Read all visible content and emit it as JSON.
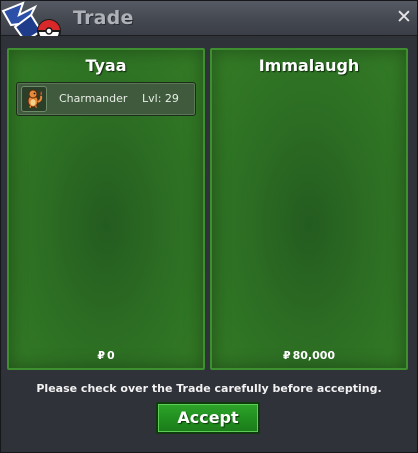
{
  "window": {
    "title": "Trade",
    "close_label": "✕",
    "logo_icon": "pokeball-logo-icon"
  },
  "trade": {
    "left_player": {
      "name": "Tyaa",
      "items": [
        {
          "icon": "charmander-icon",
          "name": "Charmander",
          "level_label": "Lvl: 29"
        }
      ],
      "currency_symbol": "₽",
      "money": "0"
    },
    "right_player": {
      "name": "Immalaugh",
      "items": [],
      "currency_symbol": "₽",
      "money": "80,000"
    }
  },
  "footer": {
    "notice": "Please check over the Trade carefully before accepting.",
    "accept_label": "Accept"
  },
  "colors": {
    "panel_border": "#3e8f2f",
    "panel_fill": "#2c6d23",
    "accept_button": "#218f20",
    "window_bg": "#30323a"
  }
}
